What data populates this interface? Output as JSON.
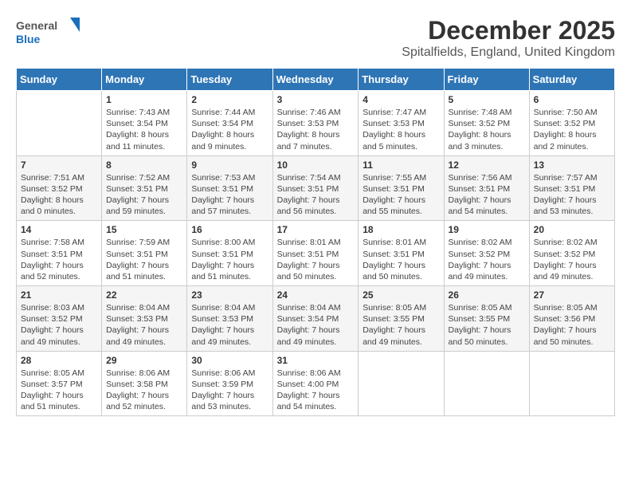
{
  "header": {
    "logo_general": "General",
    "logo_blue": "Blue",
    "month_title": "December 2025",
    "location": "Spitalfields, England, United Kingdom"
  },
  "days_of_week": [
    "Sunday",
    "Monday",
    "Tuesday",
    "Wednesday",
    "Thursday",
    "Friday",
    "Saturday"
  ],
  "weeks": [
    [
      {
        "day": "",
        "info": ""
      },
      {
        "day": "1",
        "info": "Sunrise: 7:43 AM\nSunset: 3:54 PM\nDaylight: 8 hours\nand 11 minutes."
      },
      {
        "day": "2",
        "info": "Sunrise: 7:44 AM\nSunset: 3:54 PM\nDaylight: 8 hours\nand 9 minutes."
      },
      {
        "day": "3",
        "info": "Sunrise: 7:46 AM\nSunset: 3:53 PM\nDaylight: 8 hours\nand 7 minutes."
      },
      {
        "day": "4",
        "info": "Sunrise: 7:47 AM\nSunset: 3:53 PM\nDaylight: 8 hours\nand 5 minutes."
      },
      {
        "day": "5",
        "info": "Sunrise: 7:48 AM\nSunset: 3:52 PM\nDaylight: 8 hours\nand 3 minutes."
      },
      {
        "day": "6",
        "info": "Sunrise: 7:50 AM\nSunset: 3:52 PM\nDaylight: 8 hours\nand 2 minutes."
      }
    ],
    [
      {
        "day": "7",
        "info": "Sunrise: 7:51 AM\nSunset: 3:52 PM\nDaylight: 8 hours\nand 0 minutes."
      },
      {
        "day": "8",
        "info": "Sunrise: 7:52 AM\nSunset: 3:51 PM\nDaylight: 7 hours\nand 59 minutes."
      },
      {
        "day": "9",
        "info": "Sunrise: 7:53 AM\nSunset: 3:51 PM\nDaylight: 7 hours\nand 57 minutes."
      },
      {
        "day": "10",
        "info": "Sunrise: 7:54 AM\nSunset: 3:51 PM\nDaylight: 7 hours\nand 56 minutes."
      },
      {
        "day": "11",
        "info": "Sunrise: 7:55 AM\nSunset: 3:51 PM\nDaylight: 7 hours\nand 55 minutes."
      },
      {
        "day": "12",
        "info": "Sunrise: 7:56 AM\nSunset: 3:51 PM\nDaylight: 7 hours\nand 54 minutes."
      },
      {
        "day": "13",
        "info": "Sunrise: 7:57 AM\nSunset: 3:51 PM\nDaylight: 7 hours\nand 53 minutes."
      }
    ],
    [
      {
        "day": "14",
        "info": "Sunrise: 7:58 AM\nSunset: 3:51 PM\nDaylight: 7 hours\nand 52 minutes."
      },
      {
        "day": "15",
        "info": "Sunrise: 7:59 AM\nSunset: 3:51 PM\nDaylight: 7 hours\nand 51 minutes."
      },
      {
        "day": "16",
        "info": "Sunrise: 8:00 AM\nSunset: 3:51 PM\nDaylight: 7 hours\nand 51 minutes."
      },
      {
        "day": "17",
        "info": "Sunrise: 8:01 AM\nSunset: 3:51 PM\nDaylight: 7 hours\nand 50 minutes."
      },
      {
        "day": "18",
        "info": "Sunrise: 8:01 AM\nSunset: 3:51 PM\nDaylight: 7 hours\nand 50 minutes."
      },
      {
        "day": "19",
        "info": "Sunrise: 8:02 AM\nSunset: 3:52 PM\nDaylight: 7 hours\nand 49 minutes."
      },
      {
        "day": "20",
        "info": "Sunrise: 8:02 AM\nSunset: 3:52 PM\nDaylight: 7 hours\nand 49 minutes."
      }
    ],
    [
      {
        "day": "21",
        "info": "Sunrise: 8:03 AM\nSunset: 3:52 PM\nDaylight: 7 hours\nand 49 minutes."
      },
      {
        "day": "22",
        "info": "Sunrise: 8:04 AM\nSunset: 3:53 PM\nDaylight: 7 hours\nand 49 minutes."
      },
      {
        "day": "23",
        "info": "Sunrise: 8:04 AM\nSunset: 3:53 PM\nDaylight: 7 hours\nand 49 minutes."
      },
      {
        "day": "24",
        "info": "Sunrise: 8:04 AM\nSunset: 3:54 PM\nDaylight: 7 hours\nand 49 minutes."
      },
      {
        "day": "25",
        "info": "Sunrise: 8:05 AM\nSunset: 3:55 PM\nDaylight: 7 hours\nand 49 minutes."
      },
      {
        "day": "26",
        "info": "Sunrise: 8:05 AM\nSunset: 3:55 PM\nDaylight: 7 hours\nand 50 minutes."
      },
      {
        "day": "27",
        "info": "Sunrise: 8:05 AM\nSunset: 3:56 PM\nDaylight: 7 hours\nand 50 minutes."
      }
    ],
    [
      {
        "day": "28",
        "info": "Sunrise: 8:05 AM\nSunset: 3:57 PM\nDaylight: 7 hours\nand 51 minutes."
      },
      {
        "day": "29",
        "info": "Sunrise: 8:06 AM\nSunset: 3:58 PM\nDaylight: 7 hours\nand 52 minutes."
      },
      {
        "day": "30",
        "info": "Sunrise: 8:06 AM\nSunset: 3:59 PM\nDaylight: 7 hours\nand 53 minutes."
      },
      {
        "day": "31",
        "info": "Sunrise: 8:06 AM\nSunset: 4:00 PM\nDaylight: 7 hours\nand 54 minutes."
      },
      {
        "day": "",
        "info": ""
      },
      {
        "day": "",
        "info": ""
      },
      {
        "day": "",
        "info": ""
      }
    ]
  ]
}
